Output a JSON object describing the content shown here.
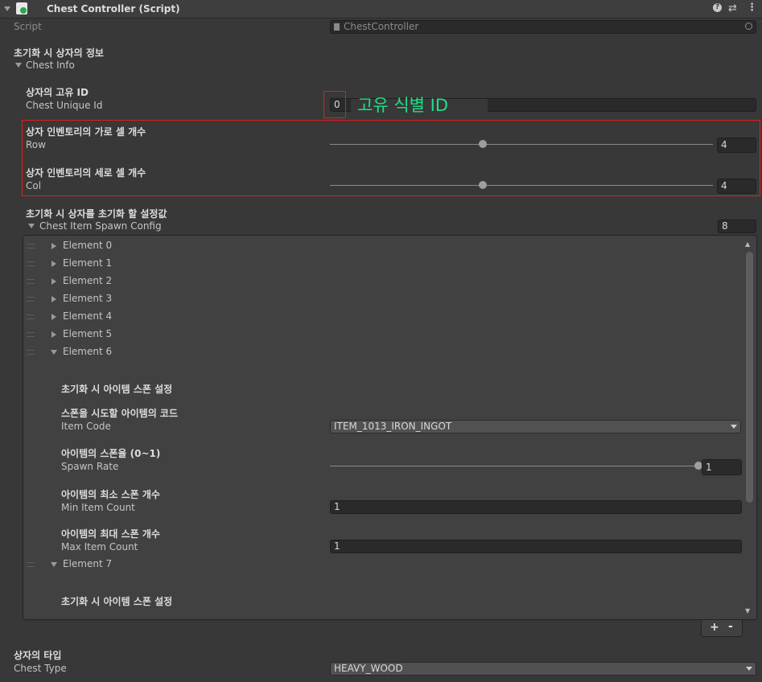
{
  "component": {
    "title": "Chest Controller (Script)",
    "script_label": "Script",
    "script_value": "ChestController"
  },
  "chest_info": {
    "header": "초기화 시 상자의 정보",
    "label": "Chest Info",
    "unique_id": {
      "header": "상자의 고유 ID",
      "label": "Chest Unique Id",
      "value": "0",
      "annotation": "고유 식별 ID"
    },
    "row": {
      "header": "상자 인벤토리의 가로 셀 개수",
      "label": "Row",
      "value": "4",
      "fraction": 0.4
    },
    "col": {
      "header": "상자 인벤토리의 세로 셀 개수",
      "label": "Col",
      "value": "4",
      "fraction": 0.4
    }
  },
  "spawn_config": {
    "header": "초기화 시 상자를 초기화 할 설정값",
    "label": "Chest Item Spawn Config",
    "size": "8",
    "elements": [
      "Element 0",
      "Element 1",
      "Element 2",
      "Element 3",
      "Element 4",
      "Element 5",
      "Element 6",
      "Element 7"
    ],
    "element6": {
      "section_header": "초기화 시 아이템 스폰 설정",
      "item_code": {
        "header": "스폰을 시도할 아이템의 코드",
        "label": "Item Code",
        "value": "ITEM_1013_IRON_INGOT"
      },
      "spawn_rate": {
        "header": "아이템의 스폰율 (0~1)",
        "label": "Spawn Rate",
        "value": "1",
        "fraction": 1.0
      },
      "min_count": {
        "header": "아이템의 최소 스폰 개수",
        "label": "Min Item Count",
        "value": "1"
      },
      "max_count": {
        "header": "아이템의 최대 스폰 개수",
        "label": "Max Item Count",
        "value": "1"
      }
    },
    "element7": {
      "section_header": "초기화 시 아이템 스폰 설정"
    },
    "add_label": "+",
    "remove_label": "-"
  },
  "chest_type": {
    "header": "상자의 타입",
    "label": "Chest Type",
    "value": "HEAVY_WOOD"
  },
  "colors": {
    "annotation": "#1fe08a",
    "highlight": "#e01e1e"
  },
  "icons": [
    "collapse-arrow-icon",
    "script-icon",
    "help-icon",
    "settings-icon",
    "kebab-menu-icon",
    "object-picker-icon",
    "dropdown-arrow-icon",
    "foldout-arrow-icon",
    "drag-handle-icon"
  ]
}
